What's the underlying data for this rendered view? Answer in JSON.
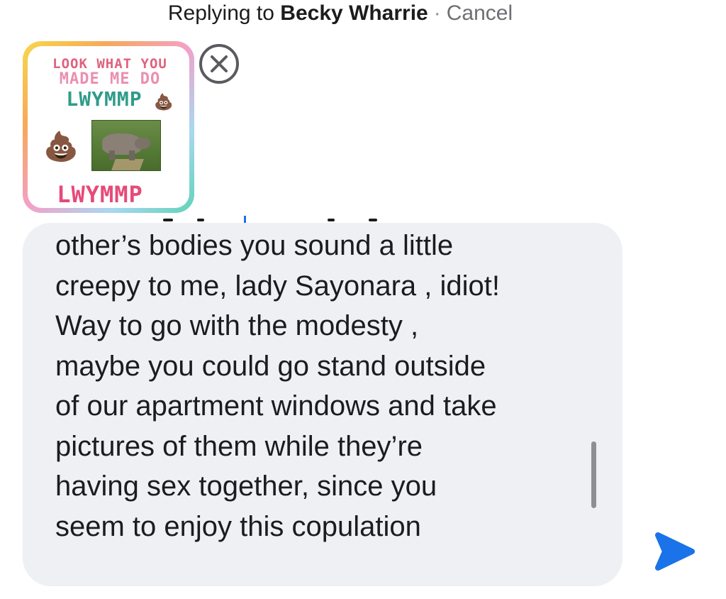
{
  "reply_header": {
    "prefix": "Replying to",
    "recipient": "Becky Wharrie",
    "separator": "·",
    "cancel_label": "Cancel"
  },
  "attachment": {
    "line1": "LOOK WHAT YOU",
    "line2": "MADE ME DO",
    "line3": "LWYMMP",
    "line4": "LWYMMP",
    "icons": [
      "poop-emoji",
      "rhino-photo"
    ],
    "remove_icon": "close-circle-icon"
  },
  "message": {
    "lines": [
      "other’s bodies you sound a little",
      "creepy to me, lady Sayonara , idiot!",
      "Way to go with the modesty ,",
      "maybe you could go stand outside",
      "of our apartment windows and take",
      "pictures of them while they’re",
      "having sex together, since you",
      "seem to enjoy this copulation"
    ]
  },
  "send": {
    "icon": "send-arrow-icon",
    "color": "#1a73e8"
  },
  "colors": {
    "bubble_background": "#eff0f4",
    "text": "#1c1c1e",
    "muted": "#6e6e73",
    "accent": "#1a73e8"
  }
}
